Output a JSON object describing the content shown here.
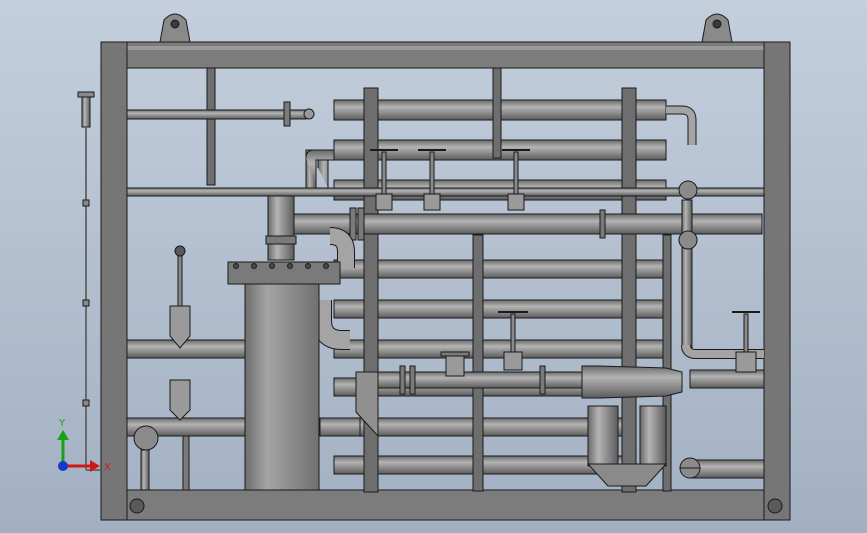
{
  "view": {
    "background_top": "#c4cfdd",
    "background_bottom": "#a2b0c2"
  },
  "model": {
    "frame_color": "#7c7c7c",
    "pipe_color": "#8e8e8e",
    "vessel_color": "#838383",
    "edge_color": "#1a1a1a"
  },
  "triad": {
    "x_label": "X",
    "y_label": "Y",
    "x_color": "#d01818",
    "y_color": "#18a018",
    "z_color": "#1838c8"
  }
}
